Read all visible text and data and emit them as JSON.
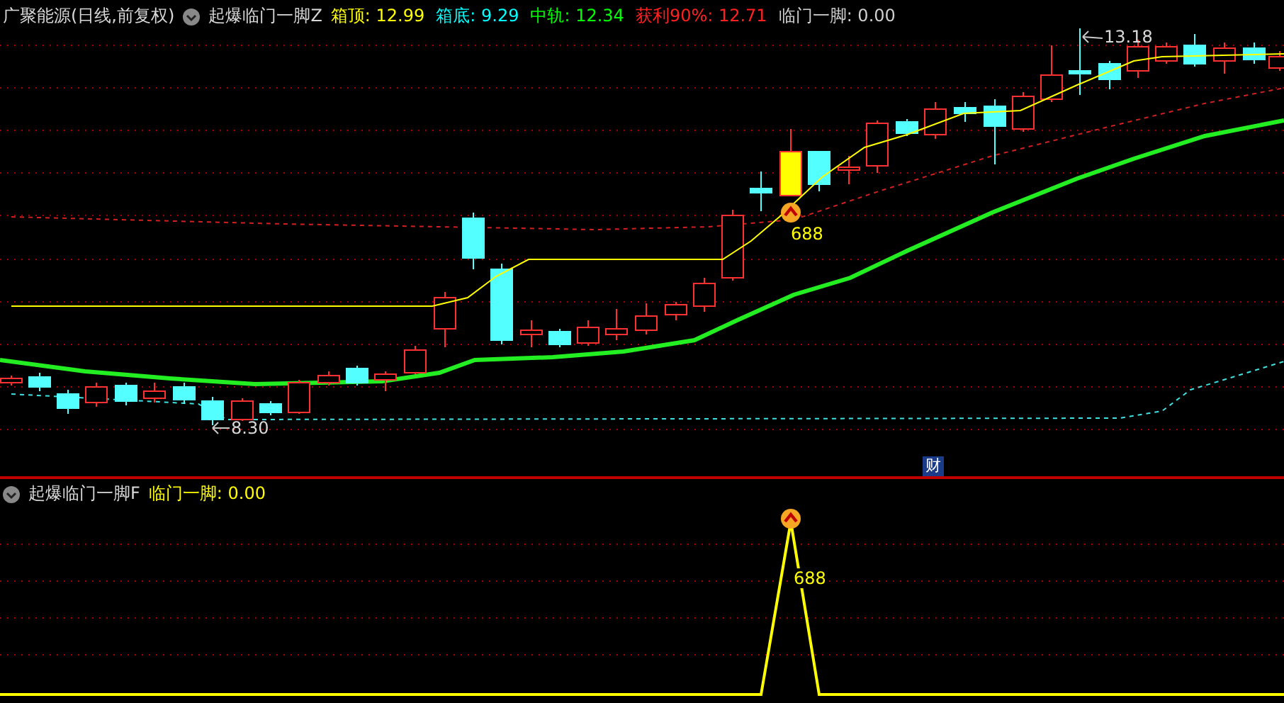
{
  "main_panel": {
    "title": "广聚能源(日线,前复权)",
    "indicator": "起爆临门一脚Z",
    "readouts": [
      {
        "text": "箱顶: 12.99",
        "color": "#ffff00"
      },
      {
        "text": "箱底: 9.29",
        "color": "#00ffff"
      },
      {
        "text": "中轨: 12.34",
        "color": "#00ff00"
      },
      {
        "text": "获利90%: 12.71",
        "color": "#ff2020"
      },
      {
        "text": "临门一脚: 0.00",
        "color": "#d0d0d0"
      }
    ],
    "high_marker": "13.18",
    "low_marker": "8.30",
    "signal_label": "688",
    "event_badge": "财"
  },
  "sub_panel": {
    "indicator": "起爆临门一脚F",
    "readouts": [
      {
        "text": "临门一脚: 0.00",
        "color": "#ffff00"
      }
    ],
    "signal_label": "688"
  }
}
